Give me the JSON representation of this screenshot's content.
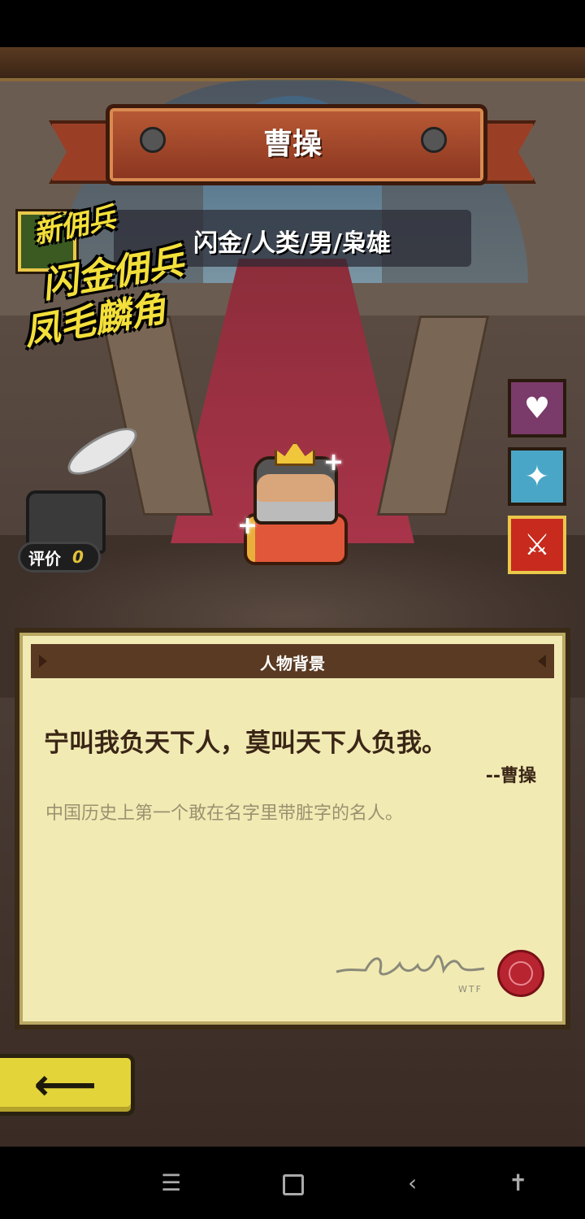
{
  "hero": {
    "name": "曹操",
    "class_line": "闪金/人类/男/枭雄"
  },
  "badge": {
    "new_label": "新佣兵",
    "line1": "闪金佣兵",
    "line2": "凤毛麟角"
  },
  "rating": {
    "label": "评价",
    "value": "0"
  },
  "skills": [
    {
      "icon": "broken-heart-icon"
    },
    {
      "icon": "magic-circle-icon"
    },
    {
      "icon": "sword-icon"
    }
  ],
  "background_panel": {
    "header": "人物背景",
    "quote": "宁叫我负天下人，莫叫天下人负我。",
    "quote_author": "--曹操",
    "description": "中国历史上第一个敢在名字里带脏字的名人。",
    "signature_mark": "WTF"
  },
  "back_button": {
    "icon": "arrow-left-icon"
  },
  "colors": {
    "ribbon": "#9a3f25",
    "panel": "#f2eab3",
    "badge_text": "#f3df3a",
    "back_button": "#e3d43a"
  }
}
